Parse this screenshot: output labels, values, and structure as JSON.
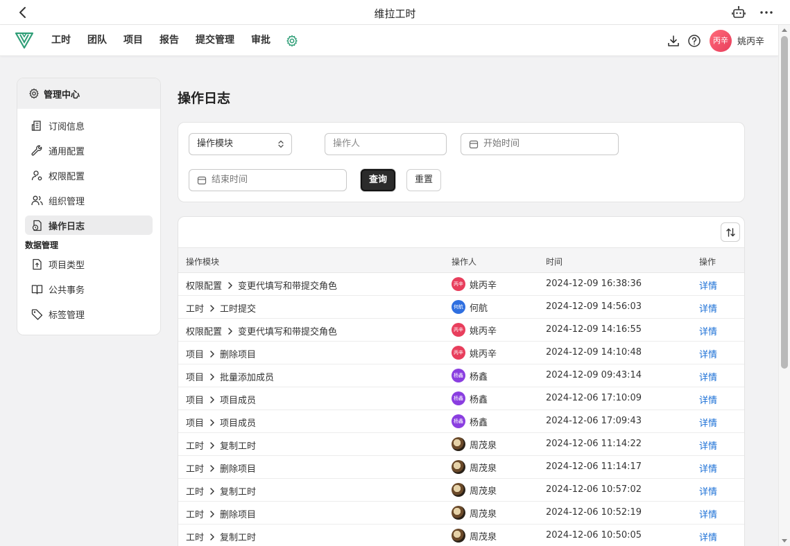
{
  "titlebar": {
    "title": "维拉工时"
  },
  "nav": {
    "items": [
      "工时",
      "团队",
      "项目",
      "报告",
      "提交管理",
      "审批"
    ],
    "user_avatar_text": "丙辛",
    "user_name": "姚丙辛"
  },
  "sidebar": {
    "header": "管理中心",
    "items": [
      {
        "label": "订阅信息",
        "icon": "building-icon"
      },
      {
        "label": "通用配置",
        "icon": "wrench-icon"
      },
      {
        "label": "权限配置",
        "icon": "user-permission-icon"
      },
      {
        "label": "组织管理",
        "icon": "users-icon"
      },
      {
        "label": "操作日志",
        "icon": "log-icon",
        "active": true
      }
    ],
    "group_label": "数据管理",
    "group_items": [
      {
        "label": "项目类型",
        "icon": "file-icon"
      },
      {
        "label": "公共事务",
        "icon": "book-icon"
      },
      {
        "label": "标签管理",
        "icon": "tag-icon"
      }
    ]
  },
  "main": {
    "title": "操作日志",
    "filter": {
      "module_select_value": "操作模块",
      "operator_placeholder": "操作人",
      "start_placeholder": "开始时间",
      "end_placeholder": "结束时间",
      "query_label": "查询",
      "reset_label": "重置"
    },
    "table": {
      "headers": [
        "操作模块",
        "操作人",
        "时间",
        "操作"
      ],
      "rows": [
        {
          "module": "权限配置",
          "sub": "变更代填写和带提交角色",
          "user": "姚丙辛",
          "avatar": "丙辛",
          "time": "2024-12-09 16:38:36",
          "action": "详情"
        },
        {
          "module": "工时",
          "sub": "工时提交",
          "user": "何航",
          "avatar": "何航",
          "time": "2024-12-09 14:56:03",
          "action": "详情"
        },
        {
          "module": "权限配置",
          "sub": "变更代填写和带提交角色",
          "user": "姚丙辛",
          "avatar": "丙辛",
          "time": "2024-12-09 14:16:55",
          "action": "详情"
        },
        {
          "module": "项目",
          "sub": "删除项目",
          "user": "姚丙辛",
          "avatar": "丙辛",
          "time": "2024-12-09 14:10:48",
          "action": "详情"
        },
        {
          "module": "项目",
          "sub": "批量添加成员",
          "user": "杨鑫",
          "avatar": "杨鑫",
          "time": "2024-12-09 09:43:14",
          "action": "详情"
        },
        {
          "module": "项目",
          "sub": "项目成员",
          "user": "杨鑫",
          "avatar": "杨鑫",
          "time": "2024-12-06 17:10:09",
          "action": "详情"
        },
        {
          "module": "项目",
          "sub": "项目成员",
          "user": "杨鑫",
          "avatar": "杨鑫",
          "time": "2024-12-06 17:09:43",
          "action": "详情"
        },
        {
          "module": "工时",
          "sub": "复制工时",
          "user": "周茂泉",
          "avatar": "",
          "time": "2024-12-06 11:14:22",
          "action": "详情"
        },
        {
          "module": "工时",
          "sub": "删除项目",
          "user": "周茂泉",
          "avatar": "",
          "time": "2024-12-06 11:14:17",
          "action": "详情"
        },
        {
          "module": "工时",
          "sub": "复制工时",
          "user": "周茂泉",
          "avatar": "",
          "time": "2024-12-06 10:57:02",
          "action": "详情"
        },
        {
          "module": "工时",
          "sub": "删除项目",
          "user": "周茂泉",
          "avatar": "",
          "time": "2024-12-06 10:52:19",
          "action": "详情"
        },
        {
          "module": "工时",
          "sub": "复制工时",
          "user": "周茂泉",
          "avatar": "",
          "time": "2024-12-06 10:50:05",
          "action": "详情"
        }
      ]
    }
  },
  "colors": {
    "brand_green": "#2f9e77",
    "link_blue": "#1a6fd6",
    "avatar_red": "#e83e5c",
    "avatar_blue": "#2f6fe0",
    "avatar_purple": "#8a3ee0"
  }
}
